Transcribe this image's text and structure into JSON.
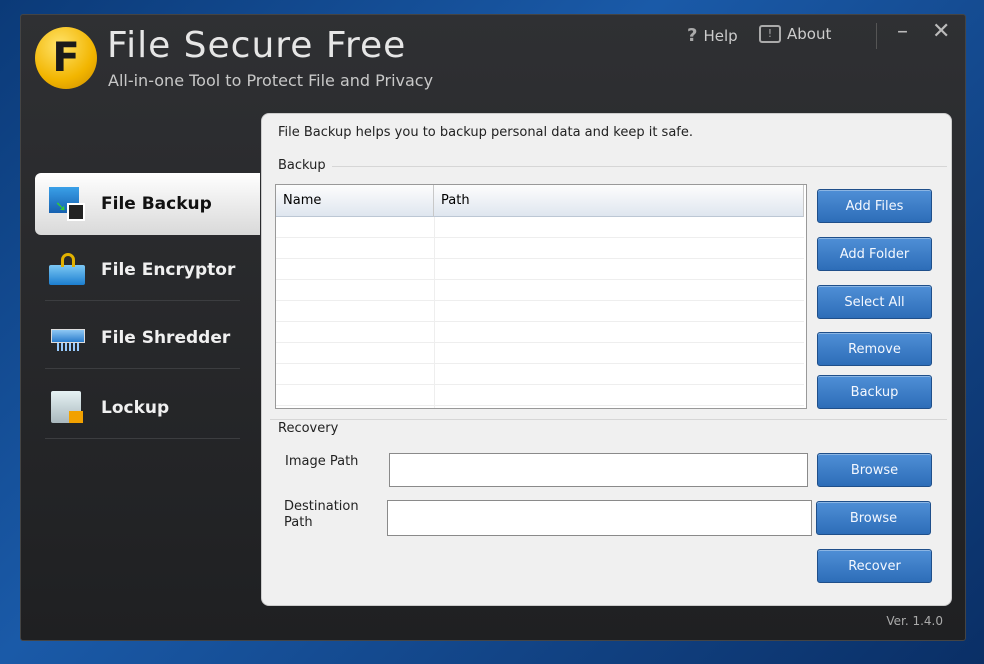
{
  "app": {
    "title": "File Secure Free",
    "subtitle": "All-in-one Tool to Protect File and Privacy",
    "logo_letter": "F",
    "version": "Ver. 1.4.0"
  },
  "topbar": {
    "help": "Help",
    "about": "About"
  },
  "sidebar": {
    "items": [
      {
        "label": "File Backup",
        "icon": "backup-icon",
        "active": true
      },
      {
        "label": "File Encryptor",
        "icon": "encrypt-folder-icon"
      },
      {
        "label": "File Shredder",
        "icon": "shredder-icon"
      },
      {
        "label": "Lockup",
        "icon": "lock-icon"
      }
    ]
  },
  "main": {
    "intro": "File Backup helps you to backup personal data and keep it safe.",
    "backup": {
      "group_label": "Backup",
      "columns": [
        "Name",
        "Path"
      ],
      "buttons": [
        "Add Files",
        "Add Folder",
        "Select All",
        "Remove",
        "Backup"
      ]
    },
    "recovery": {
      "group_label": "Recovery",
      "image_path_label": "Image Path",
      "image_path_value": "",
      "destination_label": "Destination Path",
      "destination_value": "",
      "browse": "Browse",
      "recover": "Recover"
    }
  },
  "colors": {
    "accent": "#3a7bc8",
    "logo": "#f2b500"
  }
}
